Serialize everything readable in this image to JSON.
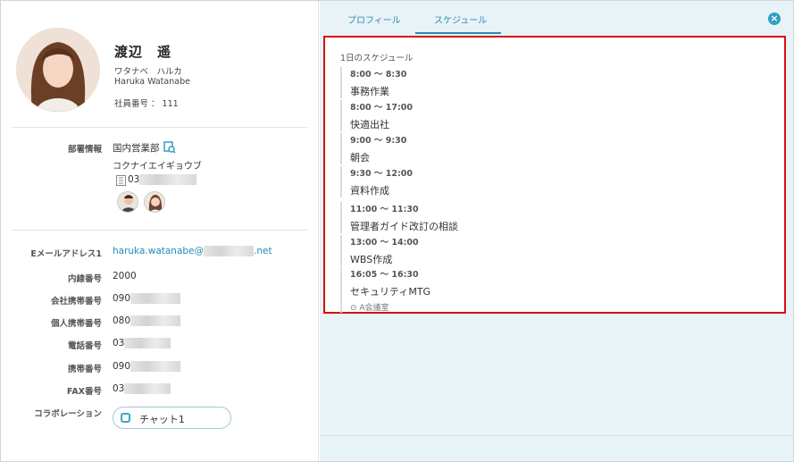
{
  "profile": {
    "name": "渡辺　遥",
    "kana": "ワタナベ　ハルカ",
    "roman": "Haruka Watanabe",
    "employee_no": "社員番号 ： 111"
  },
  "department": {
    "label": "部署情報",
    "name": "国内営業部",
    "kana": "コクナイエイギョウブ",
    "phone_prefix": "03"
  },
  "contacts": [
    {
      "label": "Eメールアドレス1",
      "prefix": "haruka.watanabe@",
      "suffix": ".net"
    },
    {
      "label": "内線番号",
      "value": "2000"
    },
    {
      "label": "会社携帯番号",
      "value": "090"
    },
    {
      "label": "個人携帯番号",
      "value": "080"
    },
    {
      "label": "電話番号",
      "value": "03"
    },
    {
      "label": "携帯番号",
      "value": "090"
    },
    {
      "label": "FAX番号",
      "value": "03"
    }
  ],
  "collaboration": {
    "label": "コラボレーション",
    "button": "チャット1"
  },
  "tabs": [
    {
      "label": "プロフィール"
    },
    {
      "label": "スケジュール",
      "active": true
    }
  ],
  "close_icon": "×",
  "schedule": {
    "title": "1日のスケジュール",
    "events": [
      {
        "time": "8:00 ～ 8:30",
        "subject": "事務作業"
      },
      {
        "time": "8:00 ～ 17:00",
        "subject": "快適出社"
      },
      {
        "time": "9:00 ～ 9:30",
        "subject": "朝会"
      },
      {
        "time": "9:30 ～ 12:00",
        "subject": "資料作成"
      },
      {
        "time": "11:00 ～ 11:30",
        "subject": "管理者ガイド改訂の相談"
      },
      {
        "time": "13:00 ～ 14:00",
        "subject": "WBS作成"
      },
      {
        "time": "16:05 ～ 16:30",
        "subject": "セキュリティMTG",
        "location": "⊙ A会議室"
      }
    ]
  },
  "colors": {
    "accent": "#2a8bb0",
    "highlight_border": "#d90f0f",
    "right_bg": "#e8f3f7"
  }
}
